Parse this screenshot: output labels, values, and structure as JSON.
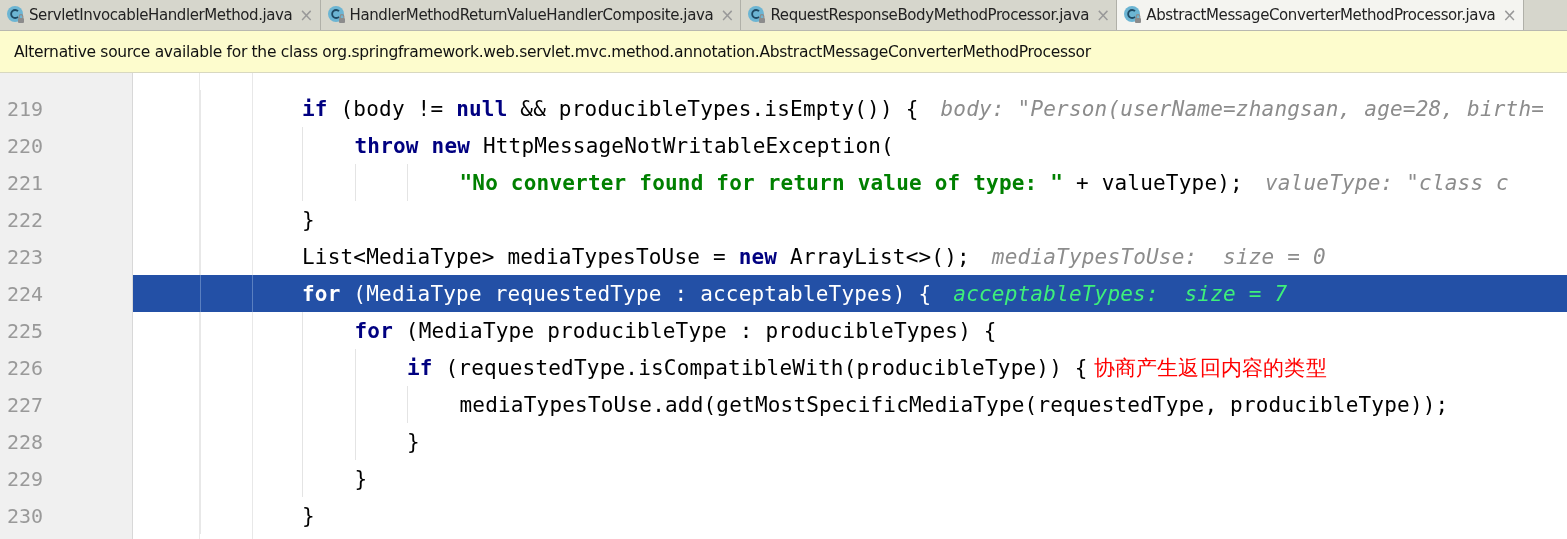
{
  "tabs": [
    {
      "label": "ServletInvocableHandlerMethod.java",
      "close": "×",
      "selected": false
    },
    {
      "label": "HandlerMethodReturnValueHandlerComposite.java",
      "close": "×",
      "selected": false
    },
    {
      "label": "RequestResponseBodyMethodProcessor.java",
      "close": "×",
      "selected": false
    },
    {
      "label": "AbstractMessageConverterMethodProcessor.java",
      "close": "×",
      "selected": true
    }
  ],
  "notice": "Alternative source available for the class org.springframework.web.servlet.mvc.method.annotation.AbstractMessageConverterMethodProcessor",
  "code_lines": [
    {
      "number": "219",
      "selected": false,
      "tokens": [
        {
          "kind": "keyword",
          "text": "if"
        },
        {
          "kind": "plain",
          "text": " (body != "
        },
        {
          "kind": "keyword",
          "text": "null"
        },
        {
          "kind": "plain",
          "text": " && producibleTypes.isEmpty()) {"
        },
        {
          "kind": "hint",
          "text": "body: \"Person(userName=zhangsan, age=28, birth="
        }
      ],
      "children": [
        {
          "number": "220",
          "selected": false,
          "tokens": [
            {
              "kind": "keyword",
              "text": "throw new"
            },
            {
              "kind": "plain",
              "text": " HttpMessageNotWritableException("
            }
          ],
          "children": [
            {
              "number": "221",
              "selected": false,
              "continuation": true,
              "tokens": [
                {
                  "kind": "string",
                  "text": "\"No converter found for return value of type: \""
                },
                {
                  "kind": "plain",
                  "text": " + valueType);"
                },
                {
                  "kind": "hint",
                  "text": "valueType: \"class c"
                }
              ]
            }
          ]
        }
      ]
    },
    {
      "number": "222",
      "selected": false,
      "tokens": [
        {
          "kind": "plain",
          "text": "}"
        }
      ]
    },
    {
      "number": "223",
      "selected": false,
      "tokens": [
        {
          "kind": "plain",
          "text": "List<MediaType> mediaTypesToUse = "
        },
        {
          "kind": "keyword",
          "text": "new"
        },
        {
          "kind": "plain",
          "text": " ArrayList<>();"
        },
        {
          "kind": "hint",
          "text": "mediaTypesToUse:  size = 0"
        }
      ]
    },
    {
      "number": "224",
      "selected": true,
      "tokens": [
        {
          "kind": "keyword",
          "text": "for"
        },
        {
          "kind": "plain",
          "text": " (MediaType requestedType : acceptableTypes) {"
        },
        {
          "kind": "hint",
          "text": "acceptableTypes:  size = 7"
        }
      ],
      "children": [
        {
          "number": "225",
          "selected": false,
          "tokens": [
            {
              "kind": "keyword",
              "text": "for"
            },
            {
              "kind": "plain",
              "text": " (MediaType producibleType : producibleTypes) {"
            }
          ],
          "children": [
            {
              "number": "226",
              "selected": false,
              "tokens": [
                {
                  "kind": "keyword",
                  "text": "if"
                },
                {
                  "kind": "plain",
                  "text": " (requestedType.isCompatibleWith(producibleType)) {"
                },
                {
                  "kind": "note",
                  "text": "协商产生返回内容的类型"
                }
              ],
              "children": [
                {
                  "number": "227",
                  "selected": false,
                  "tokens": [
                    {
                      "kind": "plain",
                      "text": "mediaTypesToUse.add(getMostSpecificMediaType(requestedType, producibleType));"
                    }
                  ]
                }
              ]
            },
            {
              "number": "228",
              "selected": false,
              "tokens": [
                {
                  "kind": "plain",
                  "text": "}"
                }
              ]
            }
          ]
        },
        {
          "number": "229",
          "selected": false,
          "tokens": [
            {
              "kind": "plain",
              "text": "}"
            }
          ]
        }
      ]
    },
    {
      "number": "230",
      "selected": false,
      "tokens": [
        {
          "kind": "plain",
          "text": "}"
        }
      ]
    }
  ]
}
